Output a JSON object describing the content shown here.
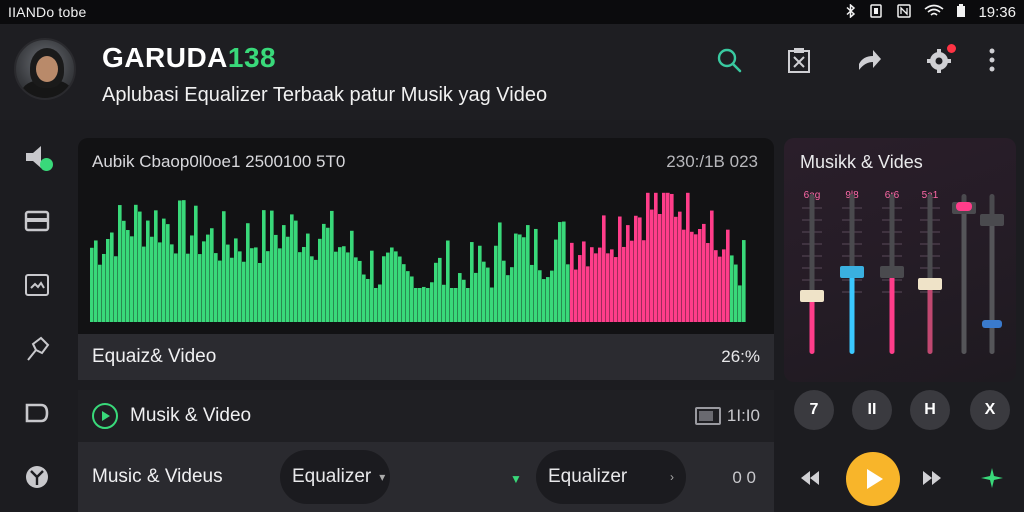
{
  "status_bar": {
    "left_text": "IIANDo tobe",
    "time": "19:36",
    "icons": [
      "bluetooth-icon",
      "vibrate-icon",
      "nfc-icon",
      "wifi-icon",
      "battery-icon"
    ]
  },
  "header": {
    "brand_white": "GARUDA",
    "brand_green": "138",
    "subtitle": "Aplubasi Equalizer Terbaak patur Musik yag Video",
    "icons": [
      "search-icon",
      "clipboard-icon",
      "share-icon",
      "settings-icon",
      "more-icon"
    ]
  },
  "sidebar": {
    "icons": [
      "speaker-icon",
      "card-icon",
      "image-icon",
      "pin-icon",
      "tag-icon",
      "shield-icon"
    ]
  },
  "visualizer": {
    "title": "Aubik Cbaop0l0oe1  2500100 5T0",
    "time": "230:/1B 023",
    "accent_green": "#39d97a",
    "accent_pink": "#ff3d8a"
  },
  "rows": {
    "row1_label": "Equaiz& Video",
    "row1_value": "26:%",
    "row2_label": "Musik & Video",
    "row2_value": "1I:I0",
    "row3_label": "Music & Videus",
    "pill1": "Equalizer",
    "pill2": "Equalizer",
    "row3_value": "0 0"
  },
  "right_panel": {
    "title": "Musikk & Vides",
    "band_labels": [
      "6ag",
      "9l8",
      "6r6",
      "5a1"
    ]
  },
  "controls": {
    "buttons": [
      "7",
      "II",
      "H",
      "X"
    ]
  }
}
